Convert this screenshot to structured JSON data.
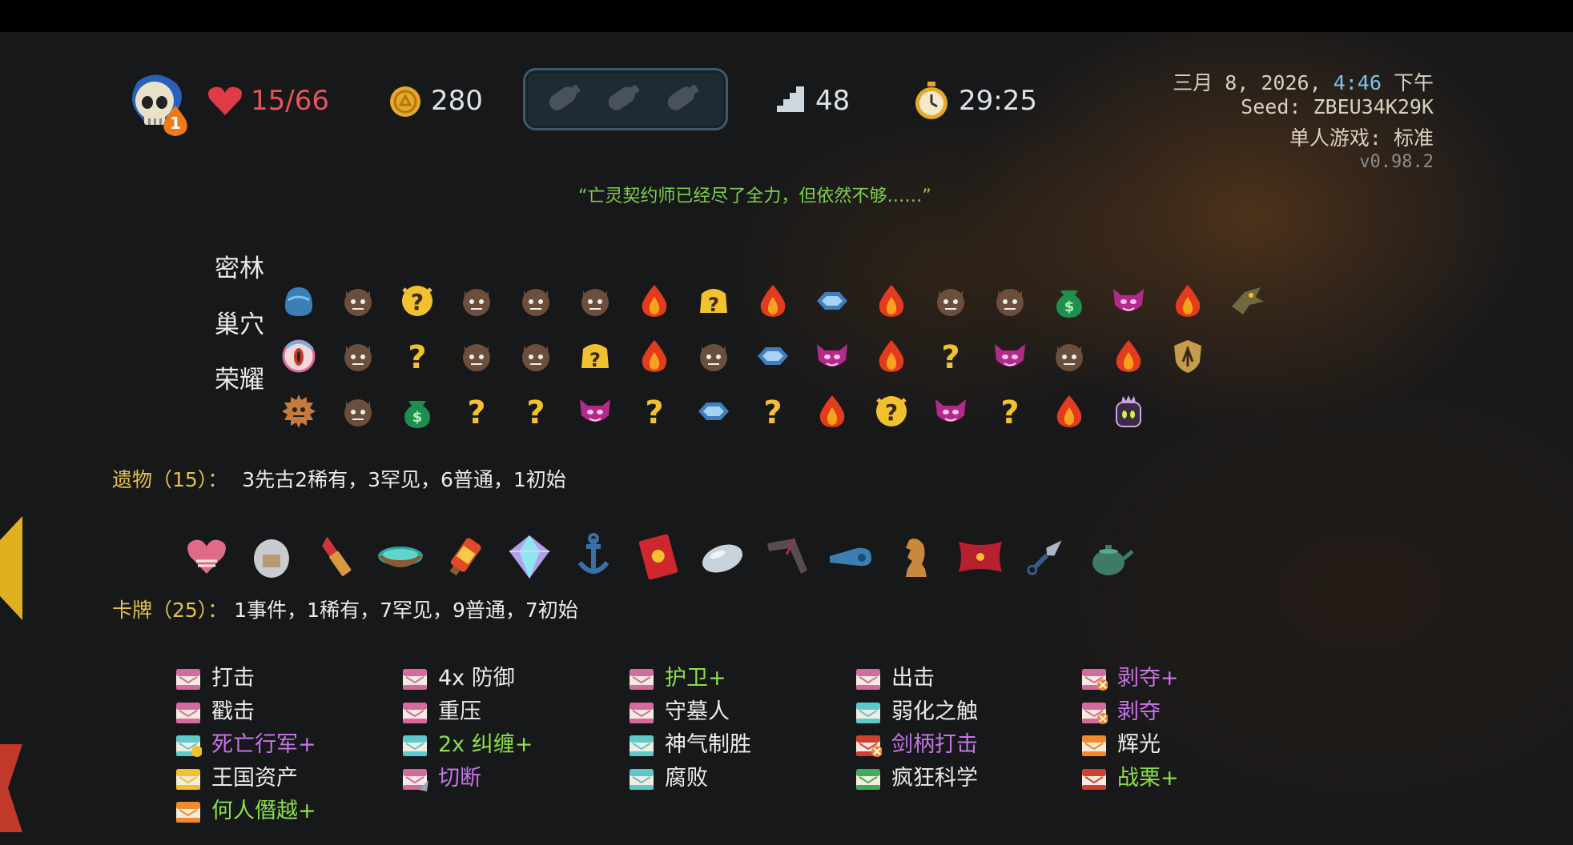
{
  "top_bar": {
    "deaths_badge": "1",
    "hp": "15/66",
    "gold": "280",
    "floor": "48",
    "timer": "29:25",
    "potion_slots": [
      "empty-potion-icon",
      "empty-potion-icon",
      "empty-potion-icon"
    ]
  },
  "run_info": {
    "date_prefix": "三月 8, 2026,",
    "time": "4:46",
    "period": "下午",
    "seed": "Seed: ZBEU34K29K",
    "mode": "单人游戏: 标准",
    "version": "v0.98.2"
  },
  "quote": "“亡灵契约师已经尽了全力，但依然不够……”",
  "map": {
    "acts": [
      {
        "name": "密林",
        "boss_icon": "slime-boss-icon",
        "nodes": [
          "monster",
          "unknown-elite",
          "monster",
          "monster",
          "monster",
          "rest",
          "unknown-shop",
          "rest",
          "treasure",
          "rest",
          "monster",
          "monster",
          "merchant",
          "elite",
          "rest",
          "boss-vulture"
        ]
      },
      {
        "name": "巢穴",
        "boss_icon": "eye-boss-icon",
        "nodes": [
          "monster",
          "unknown",
          "monster",
          "monster",
          "unknown-shop",
          "rest",
          "monster",
          "treasure",
          "elite",
          "rest",
          "unknown",
          "elite",
          "monster",
          "rest",
          "boss-shield"
        ]
      },
      {
        "name": "荣耀",
        "boss_icon": "fuzzy-boss-icon",
        "nodes": [
          "monster",
          "merchant",
          "unknown",
          "unknown",
          "elite",
          "unknown",
          "treasure",
          "unknown",
          "rest",
          "unknown-elite",
          "elite",
          "unknown",
          "rest",
          "boss-queen"
        ]
      }
    ]
  },
  "relics": {
    "label": "遗物（15）：",
    "summary": "3先古2稀有，3罕见，6普通，1初始",
    "items": [
      "bone-heart-icon",
      "jar-icon",
      "lipstick-icon",
      "bowl-icon",
      "lantern-icon",
      "prism-icon",
      "anchor-icon",
      "red-envelope-icon",
      "stone-icon",
      "boomerang-icon",
      "whistle-icon",
      "chess-knight-icon",
      "pillow-icon",
      "kunai-icon",
      "teapot-icon"
    ]
  },
  "cards": {
    "label": "卡牌（25）：",
    "summary": "1事件，1稀有，7罕见，9普通，7初始",
    "columns": [
      [
        {
          "name": "打击",
          "color": "white",
          "icon": "pink"
        },
        {
          "name": "戳击",
          "color": "white",
          "icon": "pink"
        },
        {
          "name": "死亡行军+",
          "color": "purple",
          "icon": "teal-coin"
        },
        {
          "name": "王国资产",
          "color": "white",
          "icon": "gold"
        },
        {
          "name": "何人僭越+",
          "color": "green",
          "icon": "orange"
        }
      ],
      [
        {
          "name": "4x  防御",
          "color": "white",
          "icon": "pink"
        },
        {
          "name": "重压",
          "color": "white",
          "icon": "pink"
        },
        {
          "name": "2x  纠缠+",
          "color": "green",
          "icon": "teal"
        },
        {
          "name": "切断",
          "color": "purple",
          "icon": "pink-blade"
        }
      ],
      [
        {
          "name": "护卫+",
          "color": "green",
          "icon": "pink"
        },
        {
          "name": "守墓人",
          "color": "white",
          "icon": "pink"
        },
        {
          "name": "神气制胜",
          "color": "white",
          "icon": "teal"
        },
        {
          "name": "腐败",
          "color": "white",
          "icon": "teal"
        }
      ],
      [
        {
          "name": "出击",
          "color": "white",
          "icon": "pink"
        },
        {
          "name": "弱化之触",
          "color": "white",
          "icon": "teal"
        },
        {
          "name": "剑柄打击",
          "color": "purple",
          "icon": "red-x"
        },
        {
          "name": "疯狂科学",
          "color": "white",
          "icon": "green"
        }
      ],
      [
        {
          "name": "剥夺+",
          "color": "purple",
          "icon": "pink-x"
        },
        {
          "name": "剥夺",
          "color": "purple",
          "icon": "pink-x"
        },
        {
          "name": "辉光",
          "color": "white",
          "icon": "orange"
        },
        {
          "name": "战栗+",
          "color": "green",
          "icon": "red"
        }
      ]
    ]
  },
  "colors": {
    "hp": "#e8545a",
    "gold": "#e6a92a",
    "accent_yellow": "#e6c14d",
    "quote_green": "#7fd14a",
    "upgraded_green": "#8ce04a",
    "rare_purple": "#c575e8"
  }
}
